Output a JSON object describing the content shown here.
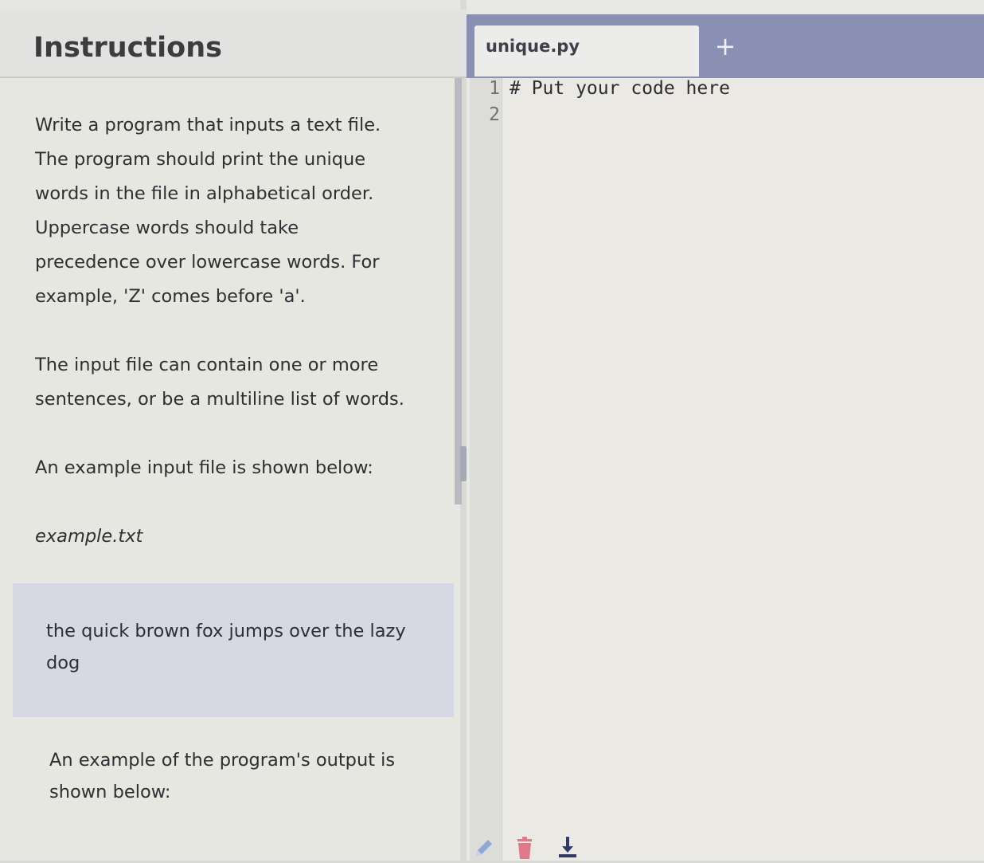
{
  "instructions": {
    "title": "Instructions",
    "paragraph1": "Write a program that inputs a text file. The program should print the unique words in the file in alphabetical order. Uppercase words should take precedence over lowercase words. For example, 'Z' comes before 'a'.",
    "paragraph2": "The input file can contain one or more sentences, or be a multiline list of words.",
    "paragraph3": "An example input file is shown below:",
    "filename": "example.txt",
    "example_content": "the quick brown fox jumps over the lazy dog",
    "paragraph4": "An example of the program's output is shown below:"
  },
  "editor": {
    "tab_label": "unique.py",
    "add_tab_label": "+",
    "line_numbers": [
      "1",
      "2"
    ],
    "lines": [
      "# Put your code here",
      ""
    ]
  },
  "toolbar": {
    "icons": [
      "pencil-icon",
      "trash-icon",
      "download-icon"
    ]
  },
  "colors": {
    "topbar": "#8a90b4",
    "example_box": "#d6d9e4",
    "trash": "#e07a8a",
    "pencil": "#8fa8d6",
    "download": "#2f3a66"
  }
}
